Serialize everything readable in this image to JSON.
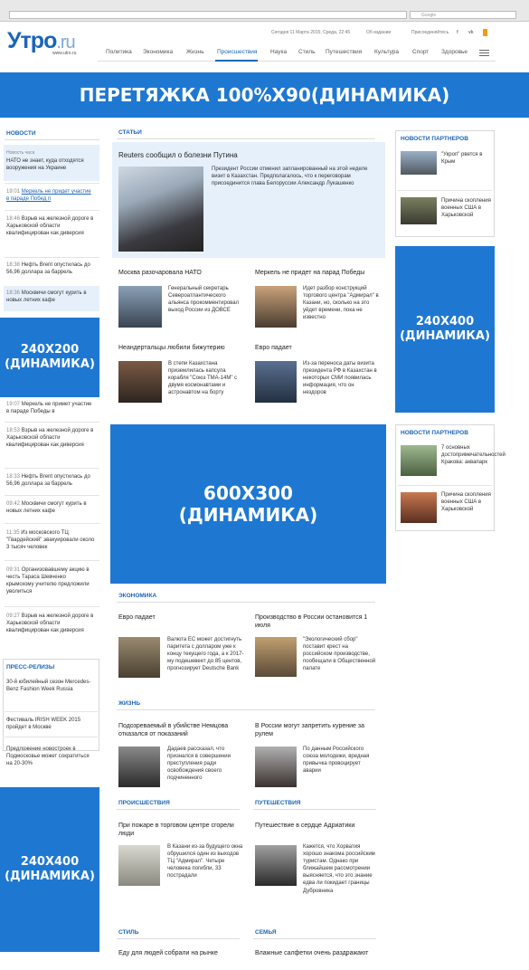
{
  "browser": {
    "search_placeholder": "Google"
  },
  "header": {
    "logo_main": "Утро",
    "logo_tld": ".ru",
    "logo_url": "www.utro.ru",
    "date": "Сегодня 11 Марта 2015, Среда, 22:45",
    "edition": "Об издании",
    "join": "Присоединяйтесь",
    "social": [
      "f",
      "vk"
    ],
    "nav": [
      "Политика",
      "Экономика",
      "Жизнь",
      "Происшествия",
      "Наука",
      "Стиль",
      "Путешествия",
      "Культура",
      "Спорт",
      "Здоровье"
    ]
  },
  "ads": {
    "top": "ПЕРЕТЯЖКА 100%X90(ДИНАМИКА)",
    "left1": "240X200 (ДИНАМИКА)",
    "center": "600X300 (ДИНАМИКА)",
    "right1": "240X400 (ДИНАМИКА)",
    "left2": "240X400 (ДИНАМИКА)"
  },
  "news": {
    "heading": "НОВОСТИ",
    "items": [
      {
        "time": "Новость часа",
        "text": "НАТО не знает, куда отходятся вооружения на Украине"
      },
      {
        "time": "19:01",
        "text": "Меркель не придет участие в параде Побед п"
      },
      {
        "time": "18:46",
        "text": "Взрыв на железной дороге в Харьковской области квалифицирован как диверсия"
      },
      {
        "time": "18:38",
        "text": "Нефть Brent опустилась до 56,96 доллара за баррель"
      },
      {
        "time": "18:36",
        "text": "Москвичи смогут курить в новых летних кафе"
      }
    ],
    "items2": [
      {
        "time": "19:07",
        "text": "Меркель не примет участие в параде Победы в"
      },
      {
        "time": "18:53",
        "text": "Взрыв на железной дороге в Харьковской области квалифицирован как диверсия"
      },
      {
        "time": "18:33",
        "text": "Нефть Brent опустилась до 56,96 доллара за баррель"
      },
      {
        "time": "09:42",
        "text": "Москвичи смогут курить в новых летних кафе"
      },
      {
        "time": "11:35",
        "text": "Из московского ТЦ \"Гвардейский\" эвакуировали около 3 тысяч человек"
      },
      {
        "time": "09:31",
        "text": "Организовавшему акцию в честь Тараса Шевченко крымскому учителю предложили уволиться"
      },
      {
        "time": "09:27",
        "text": "Взрыв на железной дороге в Харьковской области квалифицирован как диверсия"
      }
    ]
  },
  "press": {
    "heading": "ПРЕСС-РЕЛИЗЫ",
    "items": [
      "30-й юбилейный сезон Mercedes-Benz Fashion Week Russia",
      "Фестиваль IRISH WEEK 2015 пройдет в Москве",
      "Предложение новостроек в Подмосковье может сократиться на 20-30%"
    ]
  },
  "articles": {
    "heading": "СТАТЬИ",
    "lead_title": "Reuters сообщил о болезни Путина",
    "lead_text": "Президент России отменил запланированный на этой неделе визит в Казахстан. Предполагалось, что к переговорам присоединится глава Белоруссии Александр Лукашенко",
    "grid": [
      {
        "title": "Москва разочаровала НАТО",
        "text": "Генеральный секретарь Североатлантического альянса прокомментировал выход России из ДОВСЕ"
      },
      {
        "title": "Меркель не придет на парад Победы",
        "text": "Идет разбор конструкций торгового центра \"Адмирал\" в Казани, но, сколько на это уйдет времени, пока не известно"
      },
      {
        "title": "Неандертальцы любили бижутерию",
        "text": "В степи Казахстана приземлилась капсула корабля \"Союз ТМА-14М\" с двумя космонавтами и астронавтом на борту"
      },
      {
        "title": "Евро падает",
        "text": "Из-за переноса даты визита президента РФ в Казахстан в некоторых СМИ появилась информация, что он нездоров"
      }
    ]
  },
  "economy": {
    "heading": "ЭКОНОМИКА",
    "items": [
      {
        "title": "Евро падает",
        "text": "Валюта ЕС может достигнуть паритета с долларом уже к концу текущего года, а к 2017-му подешевеет до 85 центов, прогнозирует Deutsche Bank"
      },
      {
        "title": "Производство в России остановится 1 июля",
        "text": "\"Экологический сбор\" поставит крест на российском производстве, пообещали в Общественной палате"
      }
    ]
  },
  "life": {
    "heading": "ЖИЗНЬ",
    "items": [
      {
        "title": "Подозреваемый в убийстве Немцова отказался от показаний",
        "text": "Дадаев рассказал, что признался в совершении преступления ради освобождения своего подчиненного"
      },
      {
        "title": "В России могут запретить курение за рулем",
        "text": "По данным Российского союза молодежи, вредная привычка провоцирует аварии"
      }
    ]
  },
  "incidents": {
    "heading": "ПРОИСШЕСТВИЯ",
    "title": "При пожаре в торговом центре сгорели люди",
    "text": "В Казани из-за будущего окна обрушился один из выходов ТЦ \"Адмирал\". Четыре человека погибли, 33 пострадали"
  },
  "travel": {
    "heading": "ПУТЕШЕСТВИЯ",
    "title": "Путешествие в сердце Адриатики",
    "text": "Кажется, что Хорватия хорошо знакома российским туристам. Однако при ближайшем рассмотрении выясняется, что это знание едва ли покидает границы Дубровника"
  },
  "style": {
    "heading": "СТИЛЬ",
    "title": "Еду для людей собрали на рынке"
  },
  "family": {
    "heading": "СЕМЬЯ",
    "title": "Влажные салфетки очень раздражают"
  },
  "partners": {
    "heading": "НОВОСТИ ПАРТНЕРОВ",
    "items1": [
      "\"Укроп\" рвется в Крым",
      "Причина скопления военных США в Харьковской"
    ],
    "items2": [
      "7 основных достопримечательностей Кракова: аквапарк",
      "Причина скопления военных США в Харьковской"
    ]
  },
  "colors": {
    "accent": "#1a66b8",
    "ad": "#1e78d2",
    "highlight": "#e6f0fb"
  }
}
